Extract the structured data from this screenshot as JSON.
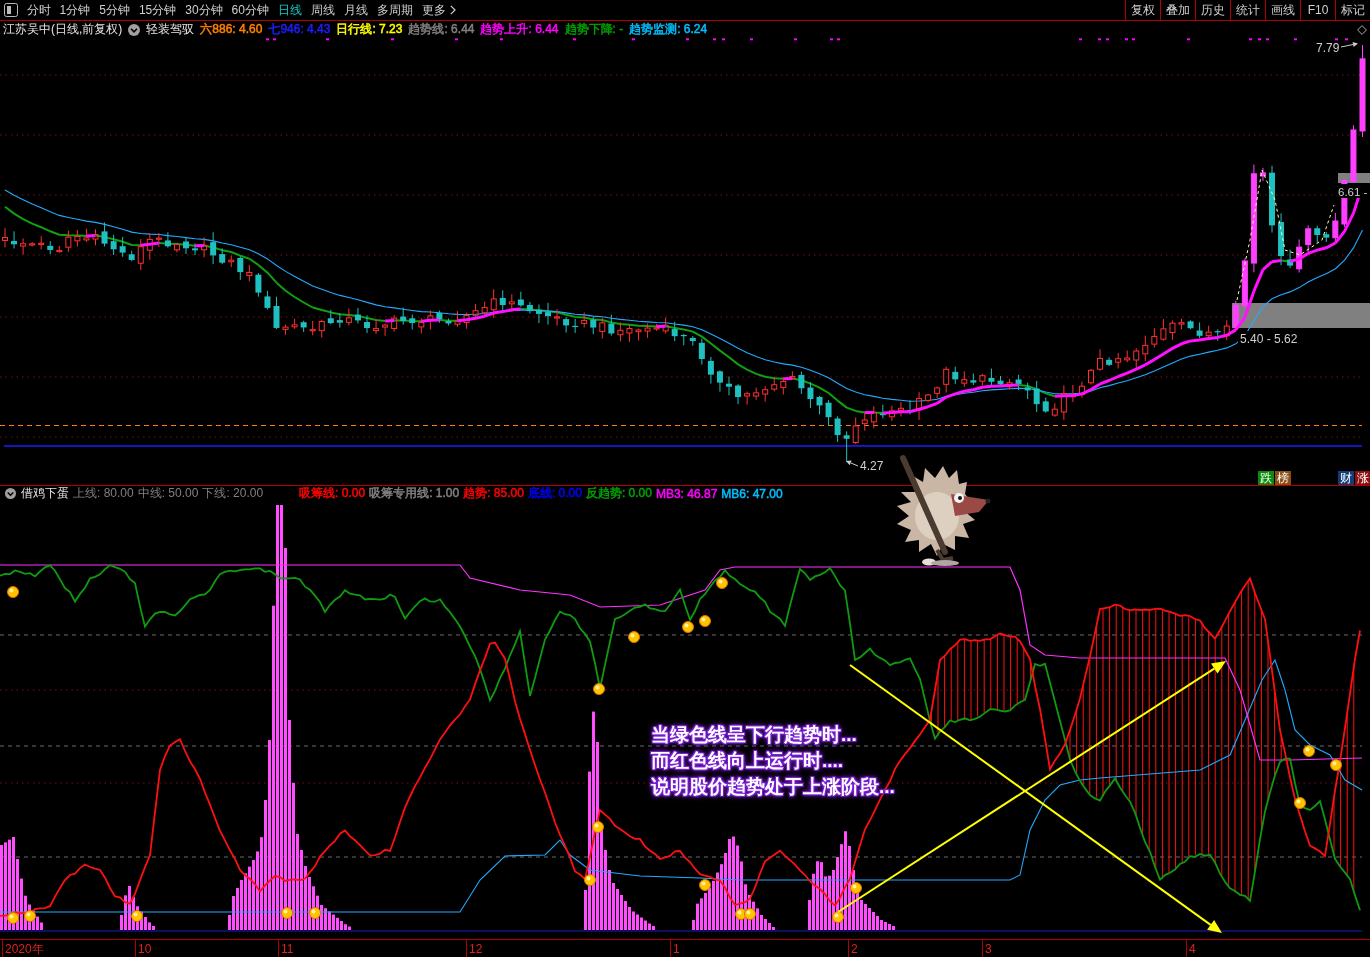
{
  "toolbar": {
    "period_tabs": [
      {
        "label": "分时",
        "selected": false
      },
      {
        "label": "1分钟",
        "selected": false
      },
      {
        "label": "5分钟",
        "selected": false
      },
      {
        "label": "15分钟",
        "selected": false
      },
      {
        "label": "30分钟",
        "selected": false
      },
      {
        "label": "60分钟",
        "selected": false
      },
      {
        "label": "日线",
        "selected": true
      },
      {
        "label": "周线",
        "selected": false
      },
      {
        "label": "月线",
        "selected": false
      },
      {
        "label": "多周期",
        "selected": false
      }
    ],
    "more_button": "更多",
    "right_buttons": [
      "复权",
      "叠加",
      "历史",
      "统计",
      "画线",
      "F10",
      "标记"
    ]
  },
  "main_chart": {
    "title": "江苏吴中(日线,前复权)",
    "indicator": "轻装驾驭",
    "legend": [
      {
        "text": "六886: 4.60",
        "color": "#ff7f00"
      },
      {
        "text": "七946: 4.43",
        "color": "#1e1eff"
      },
      {
        "text": "日行线: 7.23",
        "color": "#ffff00"
      },
      {
        "text": "趋势线: 6.44",
        "color": "#808080"
      },
      {
        "text": "趋势上升: 6.44",
        "color": "#ff00ff"
      },
      {
        "text": "趋势下降: -",
        "color": "#00a000"
      },
      {
        "text": "趋势监测: 6.24",
        "color": "#00bfff"
      }
    ],
    "price_labels": [
      {
        "kind": "high",
        "text": "7.79"
      },
      {
        "kind": "marker",
        "text": "6.61 -"
      },
      {
        "kind": "band",
        "text": "5.40 - 5.62"
      },
      {
        "kind": "low",
        "text": "4.27"
      }
    ],
    "badges": [
      {
        "text": "跌",
        "color": "#0d8a0d"
      },
      {
        "text": "榜",
        "color": "#8a4e14"
      },
      {
        "text": "财",
        "color": "#143c78"
      },
      {
        "text": "涨",
        "color": "#8c0f0f"
      }
    ]
  },
  "indicator_panel": {
    "name": "借鸡下蛋",
    "params": [
      "上线: 80.00",
      "中线: 50.00",
      "下线: 20.00"
    ],
    "legend": [
      {
        "text": "吸筹线: 0.00",
        "color": "#ff0000"
      },
      {
        "text": "吸筹专用线: 1.00",
        "color": "#808080"
      },
      {
        "text": "趋势: 85.00",
        "color": "#ff0000"
      },
      {
        "text": "底线: 0.00",
        "color": "#0000ff"
      },
      {
        "text": "反趋势: 0.00",
        "color": "#00a000"
      },
      {
        "text": "MB3: 46.87",
        "color": "#ff00ff"
      },
      {
        "text": "MB6: 47.00",
        "color": "#00bfff"
      }
    ],
    "annotation": [
      "当绿色线呈下行趋势时...",
      "而红色线向上运行时....",
      "说明股价趋势处于上涨阶段..."
    ]
  },
  "time_axis": [
    "2020年",
    "10",
    "11",
    "12",
    "1",
    "2",
    "3",
    "4"
  ]
}
